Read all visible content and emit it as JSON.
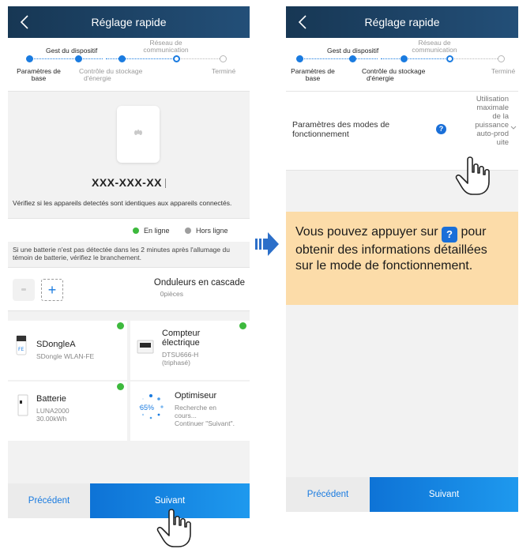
{
  "left": {
    "header": {
      "title": "Réglage rapide"
    },
    "steps": {
      "gest": "Gest du dispositif",
      "reseau_line1": "Réseau de",
      "reseau_line2": "communication",
      "params_line1": "Paramètres de",
      "params_line2": "base",
      "stockage_line1": "Contrôle du stockage",
      "stockage_line2": "d'énergie",
      "termine": "Terminé"
    },
    "device": {
      "serial": "XXX-XXX-XX",
      "verify_text": "Vérifiez si les appareils detectés sont identiques aux appareils connectés."
    },
    "legend": {
      "online": "En ligne",
      "offline": "Hors ligne"
    },
    "battery_note": "Si une batterie n'est pas détectée dans les 2 minutes après l'allumage du témoin de batterie, vérifiez le branchement.",
    "cascade": {
      "title": "Onduleurs en cascade",
      "count": "0pièces"
    },
    "devices": [
      {
        "name": "SDongleA",
        "sub": "SDongle WLAN-FE"
      },
      {
        "name_line1": "Compteur",
        "name_line2": "électrique",
        "sub_line1": "DTSU666-H",
        "sub_line2": "(triphasé)"
      },
      {
        "name": "Batterie",
        "sub_line1": "LUNA2000",
        "sub_line2": "30.00kWh"
      },
      {
        "name": "Optimiseur",
        "progress": "65%",
        "sub_line1": "Recherche en",
        "sub_line2": "cours...",
        "sub_line3": "Continuer \"Suivant\"."
      }
    ],
    "footer": {
      "prev": "Précédent",
      "next": "Suivant"
    }
  },
  "right": {
    "header": {
      "title": "Réglage rapide"
    },
    "steps": {
      "gest": "Gest du dispositif",
      "reseau_line1": "Réseau de",
      "reseau_line2": "communication",
      "params_line1": "Paramètres de",
      "params_line2": "base",
      "stockage_line1": "Contrôle du stockage",
      "stockage_line2": "d'énergie",
      "termine": "Terminé"
    },
    "mode": {
      "label_line1": "Paramètres des modes de",
      "label_line2": "fonctionnement",
      "help": "?",
      "value": [
        "Utilisation",
        "maximale",
        "de la",
        "puissance",
        "auto-prod",
        "uite"
      ]
    },
    "tip": {
      "before": "Vous pouvez appuyer sur",
      "icon": "?",
      "after": "pour obtenir des informations détaillées sur le mode de fonctionnement."
    },
    "footer": {
      "prev": "Précédent",
      "next": "Suivant"
    }
  },
  "colors": {
    "header": "#173754",
    "accent": "#1a7be0",
    "online": "#3db93d",
    "offline": "#9e9e9e",
    "tip_bg": "#fcdca9"
  }
}
